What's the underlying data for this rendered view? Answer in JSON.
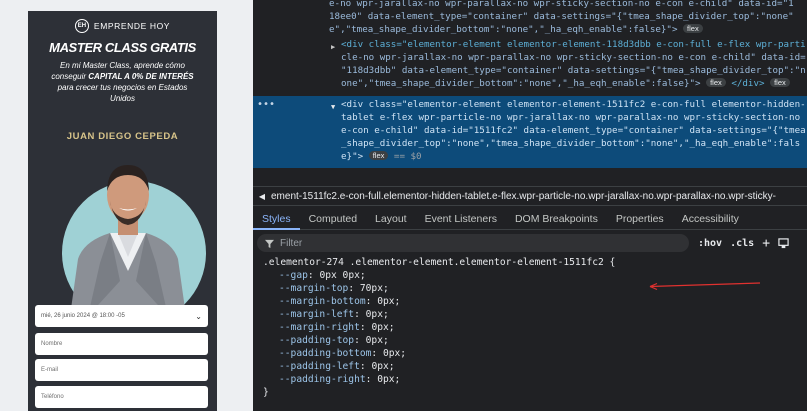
{
  "preview": {
    "brand": "EMPRENDE HOY",
    "brand_logo": "EH",
    "title": "MASTER CLASS GRATIS",
    "subtitle_1": "En mi Master Class, aprende cómo",
    "subtitle_2a": "conseguir ",
    "subtitle_2b": "CAPITAL A 0% DE INTERÉS",
    "subtitle_3": "para crecer tus negocios en Estados",
    "subtitle_4": "Unidos",
    "speaker": "JUAN DIEGO CEPEDA",
    "date_select": "mié, 26 junio 2024 @ 18:00 -05",
    "placeholder_name": "Nombre",
    "placeholder_email": "E-mail",
    "placeholder_phone": "Teléfono"
  },
  "dom": {
    "lines": [
      "e-no wpr-jarallax-no wpr-parallax-no wpr-sticky-section-no e-con e-child\" data-id=\"1",
      "18ee0\" data-element_type=\"container\" data-settings=\"{\"tmea_shape_divider_top\":\"none\"",
      "e\",\"tmea_shape_divider_bottom\":\"none\",\"_ha_eqh_enable\":false}\">",
      "<div class=\"elementor-element elementor-element-118d3dbb e-con-full e-flex wpr-parti",
      "cle-no wpr-jarallax-no wpr-parallax-no wpr-sticky-section-no e-con e-child\" data-id=",
      "\"118d3dbb\" data-element_type=\"container\" data-settings=\"{\"tmea_shape_divider_top\":\"n",
      "one\",\"tmea_shape_divider_bottom\":\"none\",\"_ha_eqh_enable\":false}\">",
      "<div class=\"elementor-element elementor-element-1511fc2 e-con-full elementor-hidden-",
      "tablet e-flex wpr-particle-no wpr-jarallax-no wpr-parallax-no wpr-sticky-section-no",
      "e-con e-child\" data-id=\"1511fc2\" data-element_type=\"container\" data-settings=\"{\"tmea",
      "_shape_divider_top\":\"none\",\"tmea_shape_divider_bottom\":\"none\",\"_ha_eqh_enable\":fals",
      "e}\">"
    ],
    "flex_badge": "flex",
    "div_close": "</div>",
    "selected_suffix": "== $0",
    "ellipsis": "•••"
  },
  "breadcrumb": "ement-1511fc2.e-con-full.elementor-hidden-tablet.e-flex.wpr-particle-no.wpr-jarallax-no.wpr-parallax-no.wpr-sticky-",
  "tabs": [
    "Styles",
    "Computed",
    "Layout",
    "Event Listeners",
    "DOM Breakpoints",
    "Properties",
    "Accessibility"
  ],
  "filter": {
    "placeholder": "Filter",
    "hov": ":hov",
    "cls": ".cls"
  },
  "rule": {
    "selector": ".elementor-274 .elementor-element.elementor-element-1511fc2 {",
    "props": [
      {
        "name": "--gap",
        "value": "0px 0px;"
      },
      {
        "name": "--margin-top",
        "value": "70px;"
      },
      {
        "name": "--margin-bottom",
        "value": "0px;"
      },
      {
        "name": "--margin-left",
        "value": "0px;"
      },
      {
        "name": "--margin-right",
        "value": "0px;"
      },
      {
        "name": "--padding-top",
        "value": "0px;"
      },
      {
        "name": "--padding-bottom",
        "value": "0px;"
      },
      {
        "name": "--padding-left",
        "value": "0px;"
      },
      {
        "name": "--padding-right",
        "value": "0px;"
      }
    ],
    "close": "}"
  },
  "colors": {
    "accent": "#8ab4f8",
    "selection": "#0d4b7a",
    "annotation": "#e0312f"
  }
}
